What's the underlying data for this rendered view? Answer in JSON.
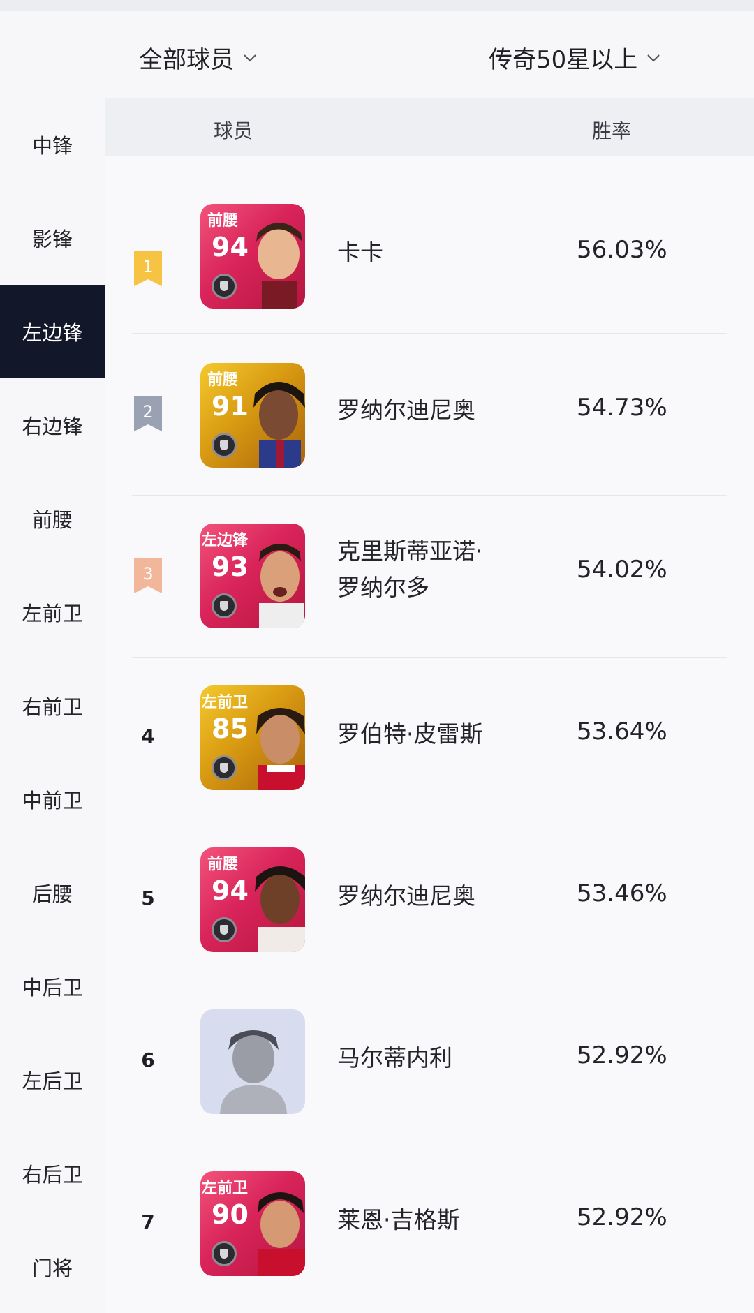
{
  "filters": {
    "players": "全部球员",
    "level": "传奇50星以上"
  },
  "sidebar": {
    "items": [
      {
        "label": "中锋",
        "active": false
      },
      {
        "label": "影锋",
        "active": false
      },
      {
        "label": "左边锋",
        "active": true
      },
      {
        "label": "右边锋",
        "active": false
      },
      {
        "label": "前腰",
        "active": false
      },
      {
        "label": "左前卫",
        "active": false
      },
      {
        "label": "右前卫",
        "active": false
      },
      {
        "label": "中前卫",
        "active": false
      },
      {
        "label": "后腰",
        "active": false
      },
      {
        "label": "中后卫",
        "active": false
      },
      {
        "label": "左后卫",
        "active": false
      },
      {
        "label": "右后卫",
        "active": false
      },
      {
        "label": "门将",
        "active": false
      }
    ]
  },
  "table": {
    "columns": {
      "player": "球员",
      "winrate": "胜率"
    },
    "rows": [
      {
        "rank": "1",
        "position": "前腰",
        "rating": "94",
        "card_color": "pink",
        "name": "卡卡",
        "winrate": "56.03%"
      },
      {
        "rank": "2",
        "position": "前腰",
        "rating": "91",
        "card_color": "gold",
        "name": "罗纳尔迪尼奥",
        "winrate": "54.73%"
      },
      {
        "rank": "3",
        "position": "左边锋",
        "rating": "93",
        "card_color": "pink",
        "name_line1": "克里斯蒂亚诺·",
        "name_line2": "罗纳尔多",
        "winrate": "54.02%"
      },
      {
        "rank": "4",
        "position": "左前卫",
        "rating": "85",
        "card_color": "gold",
        "name": "罗伯特·皮雷斯",
        "winrate": "53.64%"
      },
      {
        "rank": "5",
        "position": "前腰",
        "rating": "94",
        "card_color": "pink",
        "name": "罗纳尔迪尼奥",
        "winrate": "53.46%"
      },
      {
        "rank": "6",
        "position": "",
        "rating": "",
        "card_color": "placeholder",
        "name": "马尔蒂内利",
        "winrate": "52.92%"
      },
      {
        "rank": "7",
        "position": "左前卫",
        "rating": "90",
        "card_color": "pink",
        "name": "莱恩·吉格斯",
        "winrate": "52.92%"
      }
    ]
  },
  "colors": {
    "active_sidebar_bg": "#12172a",
    "rank1_badge": "#f6c343",
    "rank2_badge": "#9aa1b3",
    "rank3_badge": "#f2b79b",
    "card_pink": "#d9245a",
    "card_gold": "#d89a12"
  }
}
